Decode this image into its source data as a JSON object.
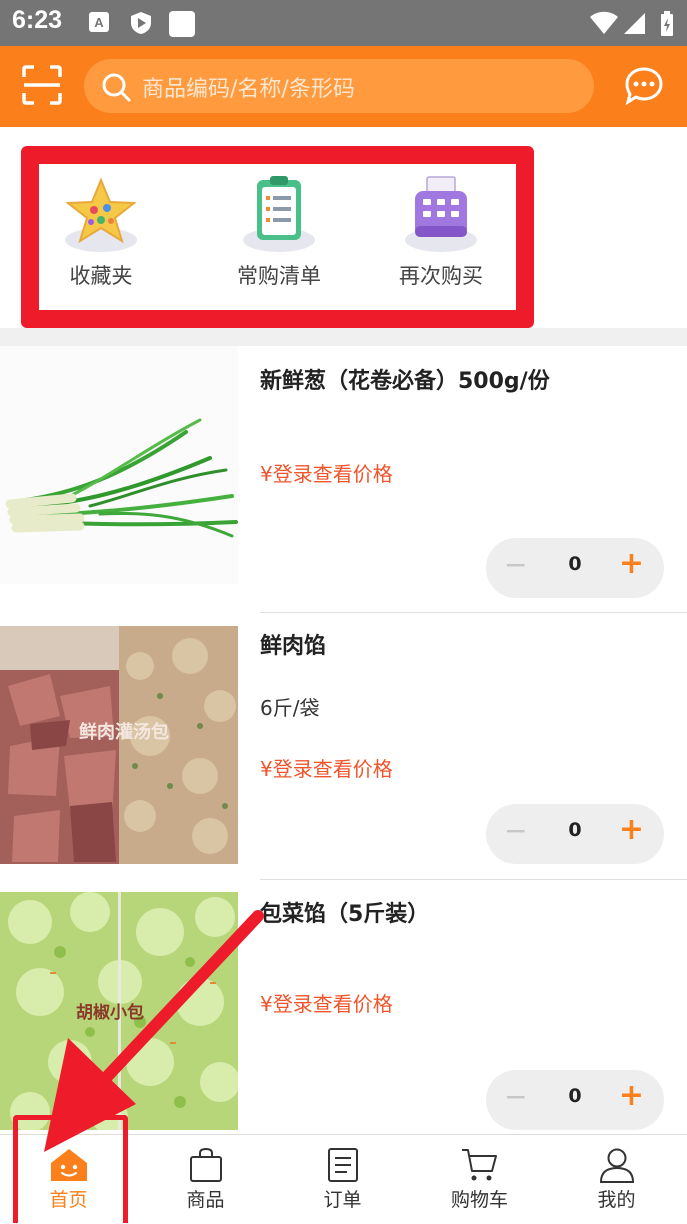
{
  "status_bar": {
    "time": "6:23"
  },
  "header": {
    "search_placeholder": "商品编码/名称/条形码",
    "scan_icon": "scan-icon",
    "message_icon": "chat-icon"
  },
  "quick_links": [
    {
      "label": "收藏夹",
      "icon": "star-icon"
    },
    {
      "label": "常购清单",
      "icon": "clipboard-icon"
    },
    {
      "label": "再次购买",
      "icon": "register-icon"
    }
  ],
  "products": [
    {
      "name": "新鲜葱（花卷必备）500g/份",
      "spec": "",
      "price": "¥登录查看价格",
      "qty": "0"
    },
    {
      "name": "鲜肉馅",
      "spec": "6斤/袋",
      "price": "¥登录查看价格",
      "qty": "0",
      "image_text": "鲜肉灌汤包"
    },
    {
      "name": "包菜馅（5斤装）",
      "spec": "",
      "price": "¥登录查看价格",
      "qty": "0",
      "image_text": "胡椒小包"
    }
  ],
  "stepper": {
    "minus": "−",
    "plus": "+"
  },
  "tabs": [
    {
      "label": "首页",
      "icon": "home-icon",
      "active": true
    },
    {
      "label": "商品",
      "icon": "bag-icon"
    },
    {
      "label": "订单",
      "icon": "order-icon"
    },
    {
      "label": "购物车",
      "icon": "cart-icon"
    },
    {
      "label": "我的",
      "icon": "user-icon"
    }
  ],
  "colors": {
    "accent": "#fb7f1a",
    "price": "#f0542b",
    "highlight": "#ee1b2b",
    "status_bar": "#757575"
  }
}
